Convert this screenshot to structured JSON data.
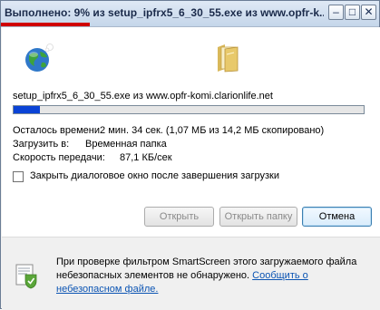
{
  "window": {
    "title_percent": "Выполнено: 9%",
    "title_rest": "из setup_ipfrx5_6_30_55.exe из www.opfr-k...",
    "min_glyph": "–",
    "max_glyph": "□",
    "close_glyph": "✕"
  },
  "download": {
    "source_line": "setup_ipfrx5_6_30_55.exe из www.opfr-komi.clarionlife.net",
    "progress_fraction": 0.0756
  },
  "info": {
    "time_left": "Осталось времени2 мин. 34 сек. (1,07 МБ из 14,2 МБ скопировано)",
    "download_to_label": "Загрузить в:",
    "download_to_value": "Временная папка",
    "speed_label": "Скорость передачи:",
    "speed_value": "87,1 КБ/сек"
  },
  "checkbox": {
    "label": "Закрыть диалоговое окно после завершения загрузки",
    "checked": false
  },
  "buttons": {
    "open": "Открыть",
    "open_folder": "Открыть папку",
    "cancel": "Отмена"
  },
  "footer": {
    "text": "При проверке фильтром SmartScreen этого загружаемого файла небезопасных элементов не обнаружено.",
    "link": "Сообщить о небезопасном файле."
  },
  "colors": {
    "progress": "#0a43d6",
    "title_marker": "#d00000",
    "link": "#0b54b3"
  }
}
